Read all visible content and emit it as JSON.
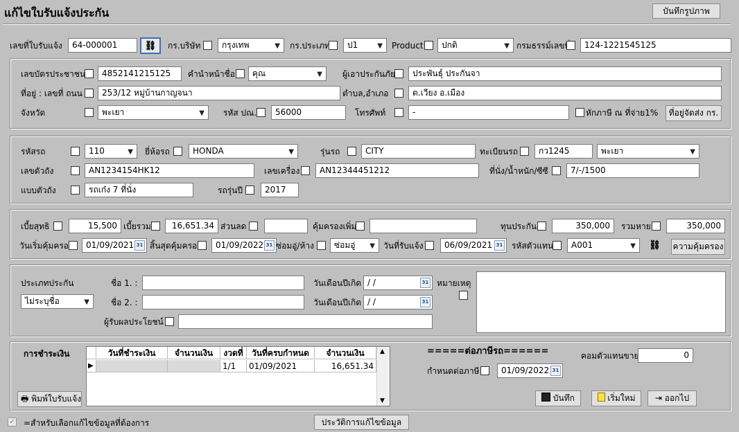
{
  "title": "แก้ไขใบรับแจ้งประกัน",
  "save_image_button": "บันทึกรูปภาพ",
  "header": {
    "receipt_no_label": "เลขที่ใบรับแจ้ง",
    "receipt_no": "64-000001",
    "company_label": "กร.บริษัท",
    "company": "กรุงเทพ",
    "type_label": "กร.ประเภท",
    "type": "ป1",
    "product_label": "Product",
    "product": "ปกติ",
    "policy_label": "กรมธรรม์เลขที่",
    "policy_no": "124-1221545125"
  },
  "customer": {
    "id_label": "เลขบัตรประชาชน",
    "id_no": "4852141215125",
    "prefix_label": "คำนำหน้าชื่อ",
    "prefix": "คุณ",
    "insured_label": "ผู้เอาประกันภัย",
    "insured": "ประพันธ์ุ ประกันจา",
    "address_label": "ที่อยู่ : เลขที่ ถนน",
    "address": "253/12 หมู่บ้านกาญจนา",
    "subdistrict_label": "ตำบล,อำเภอ",
    "subdistrict": "ต.เวียง อ.เมือง",
    "province_label": "จังหวัด",
    "province": "พะเยา",
    "postcode_label": "รหัส ปณ.",
    "postcode": "56000",
    "phone_label": "โทรศัพท์",
    "phone": "-",
    "withholding_label": "หักภาษี ณ ที่จ่าย1%",
    "ship_address_button": "ที่อยู่จัดส่ง กร."
  },
  "vehicle": {
    "code_label": "รหัสรถ",
    "code": "110",
    "brand_label": "ยี่ห้อรถ",
    "brand": "HONDA",
    "model_label": "รุ่นรถ",
    "model": "CITY",
    "plate_label": "ทะเบียนรถ",
    "plate": "กว1245",
    "plate_province": "พะเยา",
    "chassis_label": "เลขตัวถัง",
    "chassis": "AN1234154HK12",
    "engine_label": "เลขเครื่อง",
    "engine": "AN12344451212",
    "seat_label": "ที่นั่ง/น้ำหนัก/ซีซี",
    "seat": "7/-/1500",
    "body_label": "แบบตัวถัง",
    "body": "รถเก๋ง 7 ที่นั่ง",
    "year_label": "รถรุ่นปี",
    "year": "2017"
  },
  "premium": {
    "net_label": "เบี้ยสุทธิ",
    "net": "15,500",
    "total_label": "เบี้ยรวม",
    "total": "16,651.34",
    "discount_label": "ส่วนลด",
    "discount": "",
    "extra_label": "คุ้มครองเพิ่ม",
    "extra": "",
    "sum_label": "ทุนประกัน",
    "sum": "350,000",
    "total_loss_label": "รวมหาย",
    "total_loss": "350,000",
    "start_label": "วันเริ่มคุ้มครอง",
    "start": "01/09/2021",
    "end_label": "สิ้นสุดคุ้มครอง",
    "end": "01/09/2022",
    "repair_label": "ซ่อมอู่/ห้าง",
    "repair": "ซ่อมอู่",
    "notify_label": "วันที่รับแจ้ง",
    "notify": "06/09/2021",
    "agent_label": "รหัสตัวแทน",
    "agent": "A001",
    "coverage_button": "ความคุ้มครอง"
  },
  "beneficiary": {
    "type_label": "ประเภทประกัน",
    "type": "ไม่ระบุชื่อ",
    "name1_label": "ชื่อ 1. :",
    "name1": "",
    "name2_label": "ชื่อ 2. :",
    "name2": "",
    "dob_label": "วันเดือนปีเกิด",
    "dob1": " /  /",
    "dob2": " /  /",
    "remark_label": "หมายเหตุ",
    "receiver_label": "ผู้รับผลประโยชน์",
    "receiver": ""
  },
  "payment": {
    "title": "การชำระเงิน",
    "columns": [
      "วันที่ชำระเงิน",
      "จำนวนเงิน",
      "งวดที่",
      "วันที่ครบกำหนด",
      "จำนวนเงิน"
    ],
    "row": {
      "paid_date": "",
      "paid_amount": "",
      "installment": "1/1",
      "due_date": "01/09/2021",
      "amount": "16,651.34"
    },
    "print_button": "พิมพ์ใบรับแจ้ง",
    "tax_title": "=====ต่อภาษีรถ======",
    "tax_due_label": "กำหนดต่อภาษี",
    "tax_due": "01/09/2022",
    "commission_label": "คอมตัวแทนขาย",
    "commission": "0",
    "save_button": "บันทึก",
    "new_button": "เริ่มใหม่",
    "exit_button": "ออกไป"
  },
  "footer": {
    "legend": "=สำหรับเลือกแก้ไขข้อมูลที่ต้องการ",
    "history_button": "ประวัติการแก้ไขข้อมูล"
  }
}
